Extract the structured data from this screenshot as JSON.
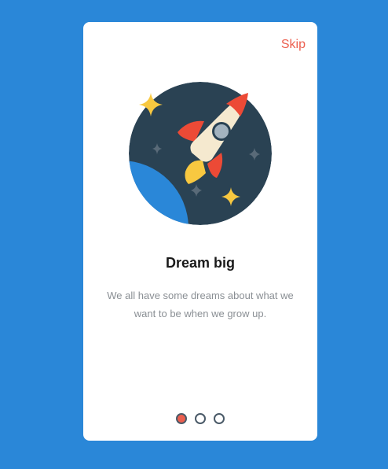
{
  "onboarding": {
    "skip_label": "Skip",
    "title": "Dream big",
    "description": "We all have some dreams about what we want to be when we grow up.",
    "illustration_icon": "rocket-icon",
    "pagination": {
      "total": 3,
      "active_index": 0
    }
  },
  "colors": {
    "background": "#2a87d8",
    "card": "#ffffff",
    "accent": "#ec5f4f",
    "space": "#2a4253",
    "planet": "#2a87d8",
    "star": "#f8c840"
  }
}
